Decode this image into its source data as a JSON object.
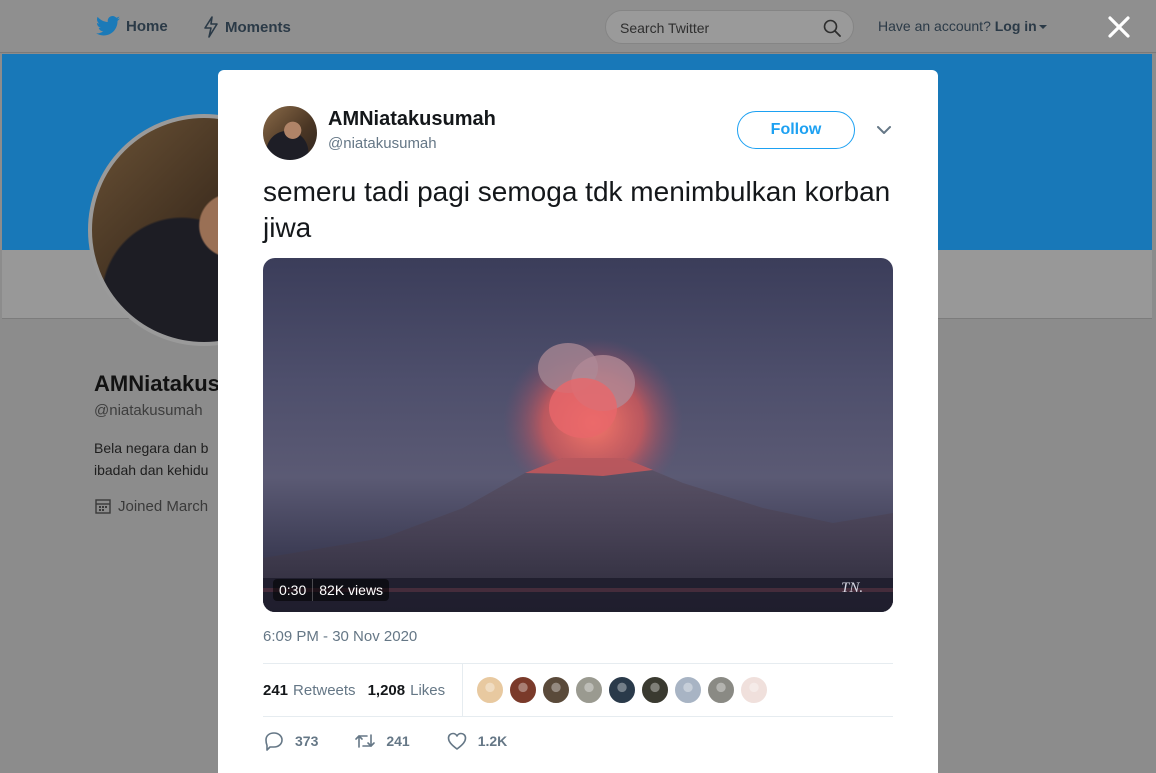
{
  "topbar": {
    "home_label": "Home",
    "moments_label": "Moments",
    "search_placeholder": "Search Twitter",
    "have_account": "Have an account?",
    "login_label": "Log in"
  },
  "profile_bg": {
    "name": "AMNiatakus",
    "handle": "@niatakusumah",
    "bio_line1": "Bela negara dan b",
    "bio_line2": "ibadah dan kehidu",
    "joined": "Joined March"
  },
  "tweet": {
    "author_name": "AMNiatakusumah",
    "author_handle": "@niatakusumah",
    "follow_label": "Follow",
    "text": "semeru tadi pagi semoga tdk menimbulkan korban jiwa",
    "video_duration": "0:30",
    "video_views": "82K views",
    "video_watermark": "TN.",
    "timestamp": "6:09 PM - 30 Nov 2020",
    "retweets_count": "241",
    "retweets_label": "Retweets",
    "likes_count": "1,208",
    "likes_label": "Likes",
    "reply_count": "373",
    "retweet_action_count": "241",
    "like_action_count": "1.2K"
  },
  "colors": {
    "accent": "#1da1f2",
    "banner": "#1878b8",
    "muted_text": "#657786"
  },
  "likers": [
    "#e8c9a0",
    "#7a3a2a",
    "#5a4a3a",
    "#9a9a90",
    "#2a3a4a",
    "#3a3a30",
    "#a8b4c4",
    "#8a8a84",
    "#f0e0dc"
  ]
}
